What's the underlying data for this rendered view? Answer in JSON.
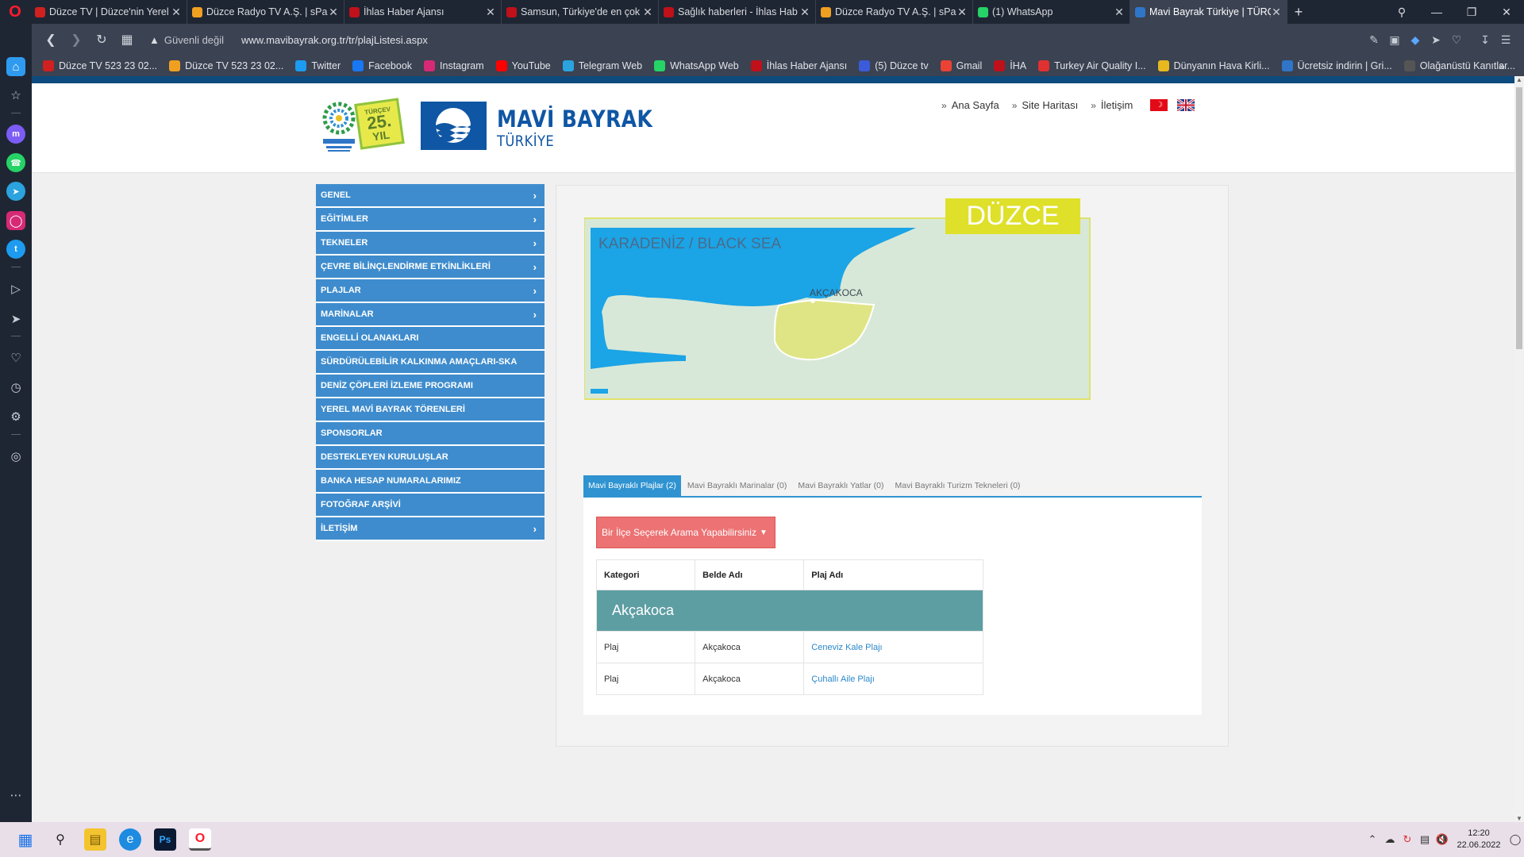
{
  "browser": {
    "tabs": [
      {
        "title": "Düzce TV | Düzce'nin Yerel",
        "color": "#d02020",
        "active": false
      },
      {
        "title": "Düzce Radyo TV A.Ş. | sPan",
        "color": "#f0a020",
        "active": false
      },
      {
        "title": "İhlas Haber Ajansı",
        "color": "#c0101a",
        "active": false
      },
      {
        "title": "Samsun, Türkiye'de en çok",
        "color": "#c0101a",
        "active": false
      },
      {
        "title": "Sağlık haberleri - İhlas Hab",
        "color": "#c0101a",
        "active": false
      },
      {
        "title": "Düzce Radyo TV A.Ş. | sPan",
        "color": "#f0a020",
        "active": false
      },
      {
        "title": "(1) WhatsApp",
        "color": "#25d366",
        "active": false
      },
      {
        "title": "Mavi Bayrak Türkiye | TÜRÇ",
        "color": "#2f76c8",
        "active": true
      }
    ],
    "security_label": "Güvenli değil",
    "url": "www.mavibayrak.org.tr/tr/plajListesi.aspx",
    "bookmarks": [
      {
        "label": "Düzce TV 523 23 02...",
        "color": "#d02020",
        "icon": "tv-icon"
      },
      {
        "label": "Düzce TV 523 23 02...",
        "color": "#f0a020",
        "icon": "grid-icon"
      },
      {
        "label": "Twitter",
        "color": "#1d9bf0",
        "icon": "twitter-icon"
      },
      {
        "label": "Facebook",
        "color": "#1877f2",
        "icon": "facebook-icon"
      },
      {
        "label": "Instagram",
        "color": "#d62976",
        "icon": "instagram-icon"
      },
      {
        "label": "YouTube",
        "color": "#ff0000",
        "icon": "youtube-icon"
      },
      {
        "label": "Telegram Web",
        "color": "#2aa3df",
        "icon": "telegram-icon"
      },
      {
        "label": "WhatsApp Web",
        "color": "#25d366",
        "icon": "whatsapp-icon"
      },
      {
        "label": "İhlas Haber Ajansı",
        "color": "#c0101a",
        "icon": "opera-icon"
      },
      {
        "label": "(5) Düzce tv",
        "color": "#3b5bdb",
        "icon": "calendar-icon"
      },
      {
        "label": "Gmail",
        "color": "#ea4335",
        "icon": "gmail-icon"
      },
      {
        "label": "İHA",
        "color": "#c0101a",
        "icon": "opera-icon"
      },
      {
        "label": "Turkey Air Quality I...",
        "color": "#e03131",
        "icon": "swiss-cross-icon"
      },
      {
        "label": "Dünyanın Hava Kirli...",
        "color": "#e8b820",
        "icon": "flag-icon"
      },
      {
        "label": "Ücretsiz indirin | Gri...",
        "color": "#2f76c8",
        "icon": "flag-icon"
      },
      {
        "label": "Olağanüstü Kanıtlar...",
        "color": "#555555",
        "icon": "magnifier-icon"
      }
    ]
  },
  "site": {
    "logo_badge": {
      "top": "TÜRÇEV",
      "number": "25.",
      "unit": "YIL"
    },
    "brand_main": "MAVİ BAYRAK",
    "brand_sub": "TÜRKİYE",
    "toplinks": [
      "Ana Sayfa",
      "Site Haritası",
      "İletişim"
    ],
    "menu": [
      {
        "label": "GENEL",
        "arrow": true
      },
      {
        "label": "EĞİTİMLER",
        "arrow": true
      },
      {
        "label": "TEKNELER",
        "arrow": true
      },
      {
        "label": "ÇEVRE BİLİNÇLENDİRME ETKİNLİKLERİ",
        "arrow": true
      },
      {
        "label": "PLAJLAR",
        "arrow": true
      },
      {
        "label": "MARİNALAR",
        "arrow": true
      },
      {
        "label": "ENGELLİ OLANAKLARI",
        "arrow": false
      },
      {
        "label": "SÜRDÜRÜLEBİLİR KALKINMA AMAÇLARI-SKA",
        "arrow": false
      },
      {
        "label": "DENİZ ÇÖPLERİ İZLEME PROGRAMI",
        "arrow": false
      },
      {
        "label": "YEREL MAVİ BAYRAK TÖRENLERİ",
        "arrow": false
      },
      {
        "label": "SPONSORLAR",
        "arrow": false
      },
      {
        "label": "DESTEKLEYEN KURULUŞLAR",
        "arrow": false
      },
      {
        "label": "BANKA HESAP NUMARALARIMIZ",
        "arrow": false
      },
      {
        "label": "FOTOĞRAF ARŞİVİ",
        "arrow": false
      },
      {
        "label": "İLETİŞİM",
        "arrow": true
      }
    ],
    "map": {
      "region_title": "DÜZCE",
      "sea_label": "KARADENİZ / BLACK SEA",
      "town_label": "AKÇAKOCA"
    },
    "result_tabs": [
      "Mavi Bayraklı Plajlar (2)",
      "Mavi Bayraklı Marinalar (0)",
      "Mavi Bayraklı Yatlar (0)",
      "Mavi Bayraklı Turizm Tekneleri (0)"
    ],
    "district_select": "Bir İlçe Seçerek Arama Yapabilirsiniz",
    "table": {
      "headers": [
        "Kategori",
        "Belde Adı",
        "Plaj Adı"
      ],
      "group": "Akçakoca",
      "rows": [
        [
          "Plaj",
          "Akçakoca",
          "Ceneviz Kale Plajı"
        ],
        [
          "Plaj",
          "Akçakoca",
          "Çuhallı Aile Plajı"
        ]
      ]
    }
  },
  "taskbar": {
    "time": "12:20",
    "date": "22.06.2022"
  }
}
